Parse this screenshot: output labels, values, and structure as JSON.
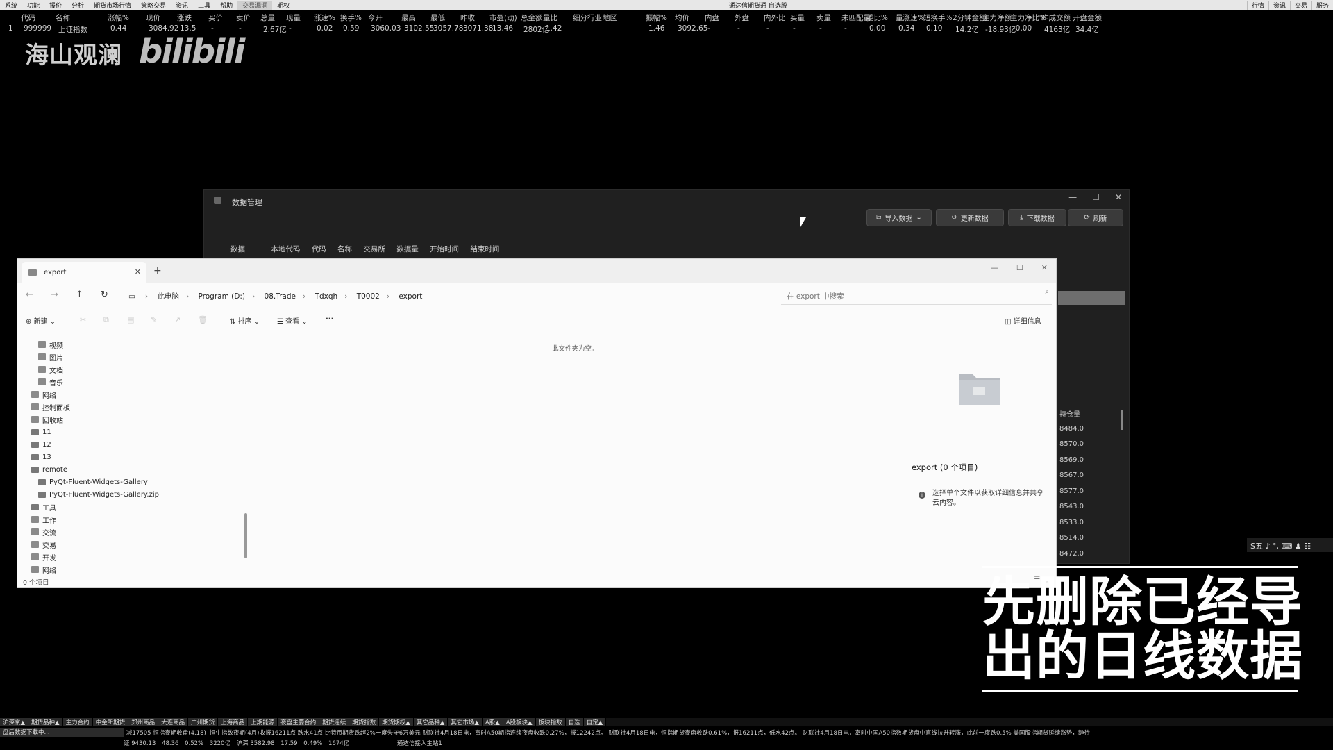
{
  "menubar": {
    "items": [
      "系统",
      "功能",
      "报价",
      "分析",
      "期货市场行情",
      "策略交易",
      "资讯",
      "工具",
      "帮助",
      "交易漏洞",
      "期权"
    ],
    "center_title": "通达信期货通  自选股",
    "right_items": [
      "行情",
      "资讯",
      "交易",
      "服务"
    ]
  },
  "quote_header": [
    "代码",
    "名称",
    "涨幅%",
    "现价",
    "涨跌",
    "买价",
    "卖价",
    "总量",
    "现量",
    "涨速%",
    "换手%",
    "今开",
    "最高",
    "最低",
    "昨收",
    "市盈(动)",
    "总金额",
    "量比",
    "细分行业",
    "地区",
    "振幅%",
    "均价",
    "内盘",
    "外盘",
    "内外比",
    "买量",
    "卖量",
    "未匹配量",
    "委比%",
    "量涨速%",
    "短换手%",
    "2分钟金额",
    "主力净额",
    "主力净比%",
    "昨成交额",
    "开盘金额"
  ],
  "quote_row": [
    "1",
    "999999",
    "上证指数",
    "0.44",
    "3084.92",
    "13.5",
    "-",
    "-",
    "2.67亿",
    "-",
    "0.02",
    "0.59",
    "3060.03",
    "3102.55",
    "3057.78",
    "3071.38",
    "13.46",
    "2802亿",
    "1.42",
    "",
    "",
    "1.46",
    "3092.65",
    "-",
    "-",
    "-",
    "-",
    "-",
    "-",
    "0.00",
    "0.34",
    "0.10",
    "14.2亿",
    "-18.93亿",
    "-0.00",
    "4163亿",
    "34.4亿"
  ],
  "watermark": {
    "text1": "海山观澜",
    "text2": "bilibili"
  },
  "data_mgmt": {
    "title": "数据管理",
    "buttons": [
      "导入数据",
      "更新数据",
      "下载数据",
      "刷新"
    ],
    "columns": [
      "数据",
      "本地代码",
      "代码",
      "名称",
      "交易所",
      "数据量",
      "开始时间",
      "结束时间"
    ],
    "hold_header": "持仓量",
    "hold_values": [
      "8484.0",
      "8570.0",
      "8569.0",
      "8567.0",
      "8577.0",
      "8543.0",
      "8533.0",
      "8514.0",
      "8472.0"
    ]
  },
  "explorer": {
    "tab_title": "export",
    "breadcrumbs": [
      "此电脑",
      "Program (D:)",
      "08.Trade",
      "Tdxqh",
      "T0002",
      "export"
    ],
    "search_placeholder": "在 export 中搜索",
    "toolbar": {
      "new": "新建",
      "sort": "排序",
      "view": "查看",
      "more": "···",
      "details": "详细信息"
    },
    "sidebar": [
      "视频",
      "图片",
      "文档",
      "音乐",
      "网络",
      "控制面板",
      "回收站",
      "11",
      "12",
      "13",
      "remote",
      "PyQt-Fluent-Widgets-Gallery",
      "PyQt-Fluent-Widgets-Gallery.zip",
      "工具",
      "工作",
      "交流",
      "交易",
      "开发",
      "网络"
    ],
    "empty_text": "此文件夹为空。",
    "detail_title": "export (0 个项目)",
    "detail_info": "选择单个文件以获取详细信息并共享云内容。",
    "status": "0 个项目"
  },
  "subtitle": {
    "line1": "先删除已经导",
    "line2": "出的日线数据"
  },
  "ime": "S五 ♪ °, ⌨ ♟ ☷",
  "bottom_tabs": [
    "沪深京▲",
    "期货品种▲",
    "主力合约",
    "中金所期货",
    "郑州商品",
    "大连商品",
    "广州期货",
    "上海商品",
    "上期能源",
    "夜盘主要合约",
    "期货连续",
    "期货指数",
    "期货期权▲",
    "其它品种▲",
    "其它市场▲",
    "A股▲",
    "A股板块▲",
    "板块指数",
    "自选",
    "自定▲"
  ],
  "ticker": {
    "left_box": "盘后数据下载中...",
    "text": "减17505        恒指夜期收盘(4.18)│恒生指数夜期(4月)收报16211点  跌水41点         比特币期货跌超2%一度失守6万美元          财联社4月18日电，富时A50期指连续夜盘收跌0.27%，报12242点。          财联社4月18日电，恒指期货夜盘收跌0.61%，报16211点，低水42点。          财联社4月18日电，富时中国A50指数期货盘中直线拉升转涨，此前一度跌0.5%          美国股指期货延续涨势，静待"
  },
  "statusbar": [
    "证 9430.13",
    "48.36",
    "0.52%",
    "3220亿",
    "沪深 3582.98",
    "17.59",
    "0.49%",
    "1674亿",
    "通达信接入主站1"
  ]
}
